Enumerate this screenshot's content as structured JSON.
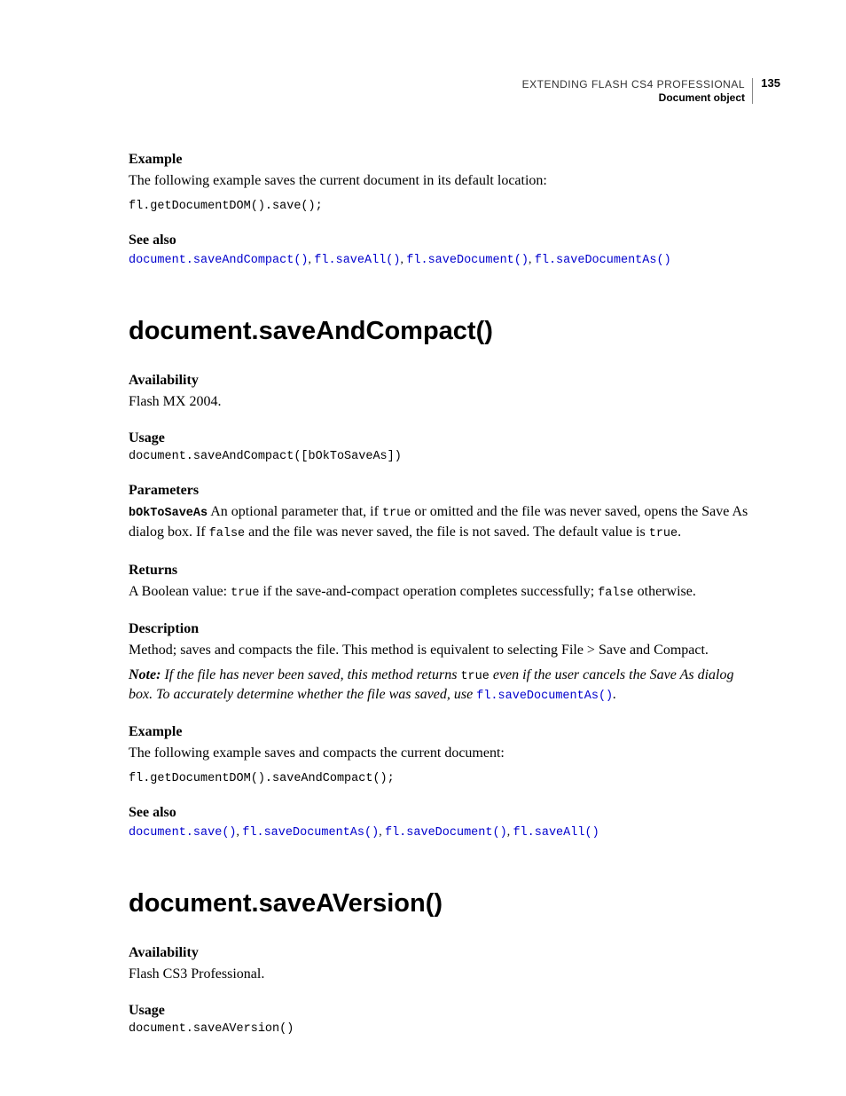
{
  "header": {
    "title": "EXTENDING FLASH CS4 PROFESSIONAL",
    "subtitle": "Document object",
    "page": "135"
  },
  "top": {
    "example_h": "Example",
    "example_body": "The following example saves the current document in its default location:",
    "example_code": "fl.getDocumentDOM().save();",
    "seealso_h": "See also",
    "links": {
      "a": "document.saveAndCompact()",
      "b": "fl.saveAll()",
      "c": "fl.saveDocument()",
      "d": "fl.saveDocumentAs()"
    }
  },
  "sac": {
    "h1": "document.saveAndCompact()",
    "avail_h": "Availability",
    "avail_body": "Flash MX 2004.",
    "usage_h": "Usage",
    "usage_code": "document.saveAndCompact([bOkToSaveAs])",
    "params_h": "Parameters",
    "param_name": "bOkToSaveAs",
    "param_text_1": " An optional parameter that, if ",
    "param_true": "true",
    "param_text_2": " or omitted and the file was never saved, opens the Save As dialog box. If ",
    "param_false": "false",
    "param_text_3": " and the file was never saved, the file is not saved. The default value is ",
    "param_true2": "true",
    "param_text_4": ".",
    "returns_h": "Returns",
    "returns_1": "A Boolean value: ",
    "returns_true": "true",
    "returns_2": " if the save-and-compact operation completes successfully; ",
    "returns_false": "false",
    "returns_3": " otherwise.",
    "desc_h": "Description",
    "desc_body": "Method; saves and compacts the file. This method is equivalent to selecting File > Save and Compact.",
    "note_strong": "Note:",
    "note_1": " If the file has never been saved, this method returns ",
    "note_true": "true",
    "note_2": " even if the user cancels the Save As dialog box. To accurately determine whether the file was saved, use ",
    "note_link": "fl.saveDocumentAs()",
    "note_3": ".",
    "example_h": "Example",
    "example_body": "The following example saves and compacts the current document:",
    "example_code": "fl.getDocumentDOM().saveAndCompact();",
    "seealso_h": "See also",
    "links": {
      "a": "document.save()",
      "b": "fl.saveDocumentAs()",
      "c": "fl.saveDocument()",
      "d": "fl.saveAll()"
    }
  },
  "sav": {
    "h1": "document.saveAVersion()",
    "avail_h": "Availability",
    "avail_body": "Flash CS3 Professional.",
    "usage_h": "Usage",
    "usage_code": "document.saveAVersion()"
  }
}
